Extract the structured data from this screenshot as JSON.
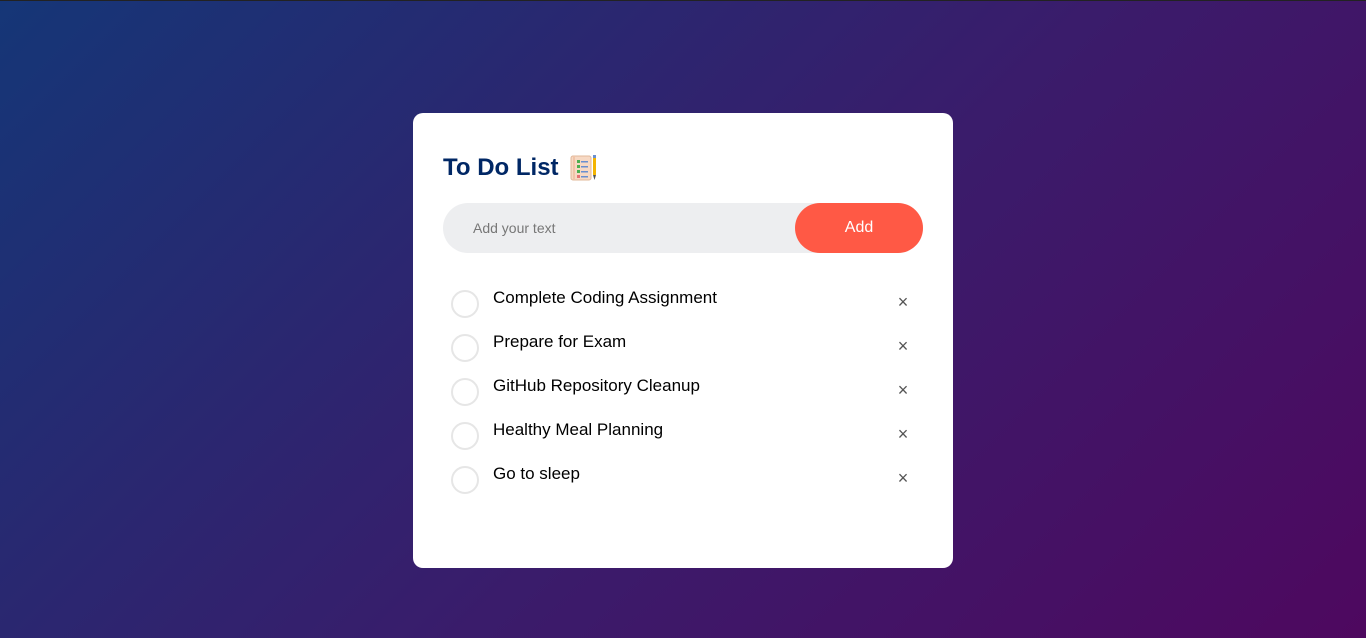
{
  "app": {
    "title": "To Do List",
    "title_icon": "notepad-checklist-icon"
  },
  "input": {
    "placeholder": "Add your text",
    "value": ""
  },
  "add_button": {
    "label": "Add"
  },
  "tasks": [
    {
      "text": "Complete Coding Assignment",
      "checked": false
    },
    {
      "text": "Prepare for Exam",
      "checked": false
    },
    {
      "text": "GitHub Repository Cleanup",
      "checked": false
    },
    {
      "text": "Healthy Meal Planning",
      "checked": false
    },
    {
      "text": "Go to sleep",
      "checked": false
    }
  ],
  "remove_glyph": "×",
  "colors": {
    "title": "#002765",
    "accent": "#ff5945",
    "input_bg": "#edeef0",
    "gradient_start": "#153677",
    "gradient_end": "#4e085f"
  }
}
